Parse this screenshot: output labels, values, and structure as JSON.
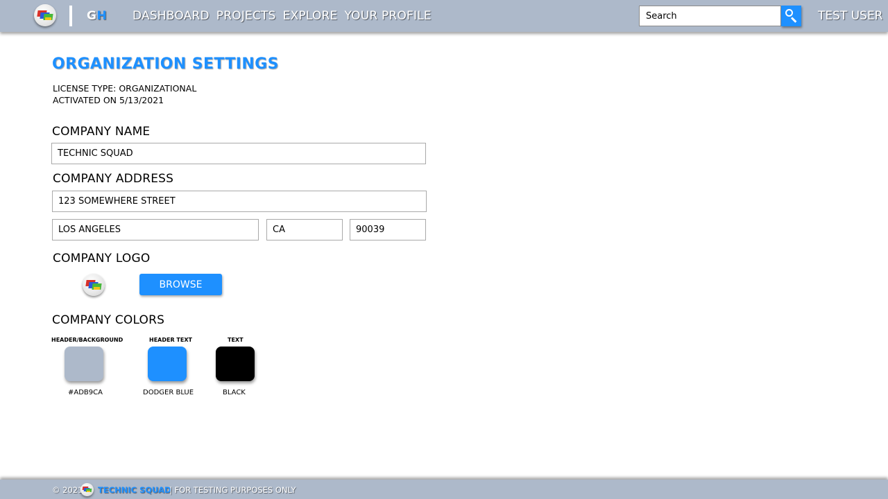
{
  "header": {
    "logo_letters": {
      "first": "G",
      "second": "H"
    },
    "nav": [
      "DASHBOARD",
      "PROJECTS",
      "EXPLORE",
      "YOUR PROFILE"
    ],
    "search": {
      "placeholder": "Search",
      "value": ""
    },
    "user": "TEST USER"
  },
  "main": {
    "title": "ORGANIZATION SETTINGS",
    "license_type": "LICENSE TYPE: ORGANIZATIONAL",
    "activated": "ACTIVATED ON  5/13/2021",
    "company_name": {
      "label": "COMPANY NAME",
      "value": "TECHNIC SQUAD"
    },
    "company_address": {
      "label": "COMPANY ADDRESS",
      "street": "123 SOMEWHERE STREET",
      "city": "LOS ANGELES",
      "state": "CA",
      "zip": "90039"
    },
    "company_logo": {
      "label": "COMPANY LOGO",
      "browse_label": "BROWSE"
    },
    "company_colors": {
      "label": "COMPANY COLORS",
      "swatches": [
        {
          "label": "HEADER/BACKGROUND",
          "name": "#ADB9CA",
          "color": "#adb9ca"
        },
        {
          "label": "HEADER  TEXT",
          "name": "DODGER BLUE",
          "color": "#1e90ff"
        },
        {
          "label": "TEXT",
          "name": "BLACK",
          "color": "#000000"
        }
      ]
    }
  },
  "footer": {
    "copyright": "© 2021",
    "brand": "TECHNIC  SQUAD",
    "note": "| FOR  TESTING  PURPOSES  ONLY"
  }
}
